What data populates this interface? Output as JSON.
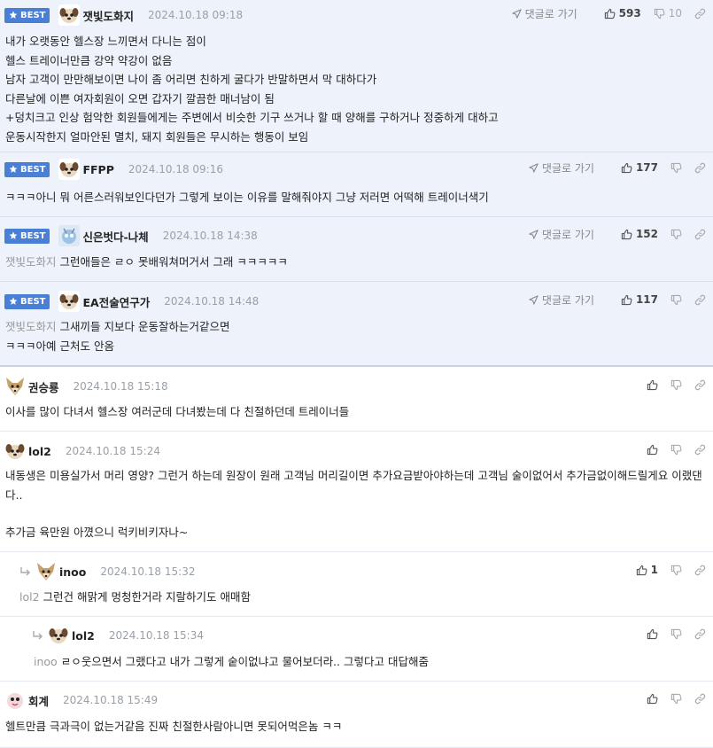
{
  "labels": {
    "best": "BEST",
    "reply": "댓글로 가기"
  },
  "colors": {
    "best_bg": "#eef3fb",
    "badge": "#4a7fd6"
  },
  "comments": [
    {
      "nick": "잿빛도화지",
      "date": "2024.10.18 09:18",
      "likes": "593",
      "dislikes": "10",
      "best": true,
      "avatar": "dog-avatar",
      "lines": [
        "내가 오랫동안 헬스장 느끼면서 다니는 점이",
        "헬스 트레이너만큼 강약 약강이 없음",
        "남자 고객이 만만해보이면 나이 좀 어리면 친하게 굴다가 반말하면서 막 대하다가",
        "다른날에 이쁜 여자회원이 오면 갑자기 깔끔한 매너남이 됨",
        "+덩치크고 인상 험악한 회원들에게는 주변에서 비슷한 기구 쓰거나 할 때 양해를 구하거나 정중하게 대하고",
        "운동시작한지 얼마안된 멸치, 돼지 회원들은 무시하는 행동이 보임"
      ]
    },
    {
      "nick": "FFPP",
      "date": "2024.10.18 09:16",
      "likes": "177",
      "best": true,
      "avatar": "dog-avatar",
      "lines": [
        "ㅋㅋㅋ아니 뭐 어른스러워보인다던가 그렇게 보이는 이유를 말해줘야지 그냥 저러면 어떡해 트레이너색기"
      ]
    },
    {
      "nick": "신은벗다-나체",
      "date": "2024.10.18 14:38",
      "likes": "152",
      "best": true,
      "avatar": "robot-avatar",
      "mention": "잿빛도화지",
      "lines": [
        "그런애들은 ㄹㅇ 못배워쳐머거서 그래 ㅋㅋㅋㅋㅋ"
      ]
    },
    {
      "nick": "EA전술연구가",
      "date": "2024.10.18 14:48",
      "likes": "117",
      "best": true,
      "avatar": "dog-avatar",
      "mention": "잿빛도화지",
      "lines": [
        "그새끼들 지보다 운동잘하는거같으면",
        "ㅋㅋㅋ아예 근처도 안옴"
      ]
    },
    {
      "nick": "권승룡",
      "date": "2024.10.18 15:18",
      "avatar": "fox-avatar",
      "lines": [
        "이사를 많이 다녀서 헬스장 여러군데 다녀봤는데 다 친절하던데 트레이너들"
      ]
    },
    {
      "nick": "lol2",
      "date": "2024.10.18 15:24",
      "avatar": "dog-avatar",
      "lines": [
        "내동생은 미용실가서 머리 영양? 그런거 하는데 원장이 원래 고객님 머리길이면 추가요금받아야하는데 고객님 술이없어서 추가금없이해드릴게요 이랬댄다..",
        "",
        "추가금 육만원 아꼈으니 럭키비키자나~"
      ]
    },
    {
      "nick": "inoo",
      "date": "2024.10.18 15:32",
      "likes": "1",
      "avatar": "fox-avatar",
      "mention": "lol2",
      "depth": 1,
      "lines": [
        "그런건 해맑게 멍청한거라 지랄하기도 애매함"
      ]
    },
    {
      "nick": "lol2",
      "date": "2024.10.18 15:34",
      "avatar": "dog-avatar",
      "mention": "inoo",
      "depth": 2,
      "lines": [
        "ㄹㅇ웃으면서 그랬다고 내가 그렇게 숱이없냐고 물어보더라.. 그렇다고 대답해줌"
      ]
    },
    {
      "nick": "회계",
      "date": "2024.10.18 15:49",
      "avatar": "pink-avatar",
      "lines": [
        "헬트만큼 극과극이 없는거같음 진짜 친절한사람아니면 못되어먹은놈 ㅋㅋ"
      ]
    }
  ]
}
